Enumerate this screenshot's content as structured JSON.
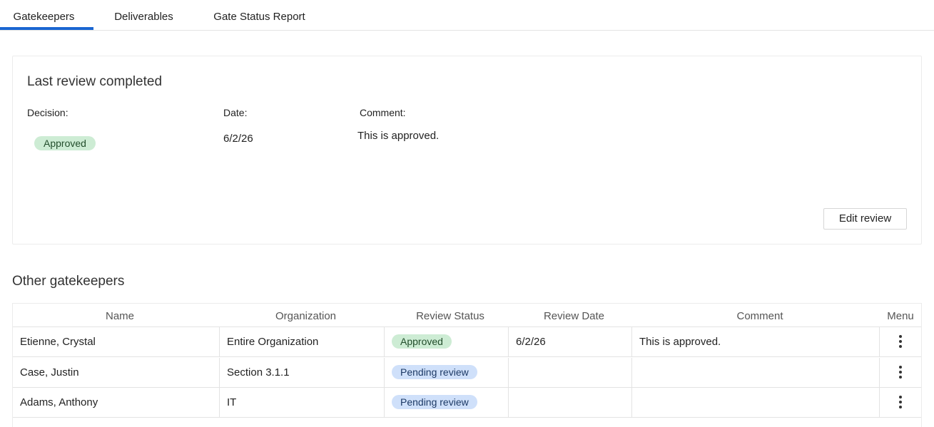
{
  "tabs": [
    {
      "label": "Gatekeepers",
      "active": true
    },
    {
      "label": "Deliverables",
      "active": false
    },
    {
      "label": "Gate Status Report",
      "active": false
    }
  ],
  "last_review": {
    "title": "Last review completed",
    "decision_label": "Decision:",
    "date_label": "Date:",
    "comment_label": "Comment:",
    "decision": "Approved",
    "date": "6/2/26",
    "comment": "This is approved.",
    "edit_button": "Edit review"
  },
  "other_gatekeepers": {
    "title": "Other gatekeepers",
    "columns": [
      "Name",
      "Organization",
      "Review Status",
      "Review Date",
      "Comment",
      "Menu"
    ],
    "rows": [
      {
        "name": "Etienne, Crystal",
        "organization": "Entire Organization",
        "status": "Approved",
        "status_kind": "approved",
        "date": "6/2/26",
        "comment": "This is approved."
      },
      {
        "name": "Case, Justin",
        "organization": "Section 3.1.1",
        "status": "Pending review",
        "status_kind": "pending",
        "date": "",
        "comment": ""
      },
      {
        "name": "Adams, Anthony",
        "organization": "IT",
        "status": "Pending review",
        "status_kind": "pending",
        "date": "",
        "comment": ""
      }
    ]
  },
  "colors": {
    "accent": "#1a66d2",
    "approved_bg": "#cdecd4",
    "pending_bg": "#cfe0fa"
  },
  "icons": {
    "row_menu": "kebab-menu-icon"
  }
}
